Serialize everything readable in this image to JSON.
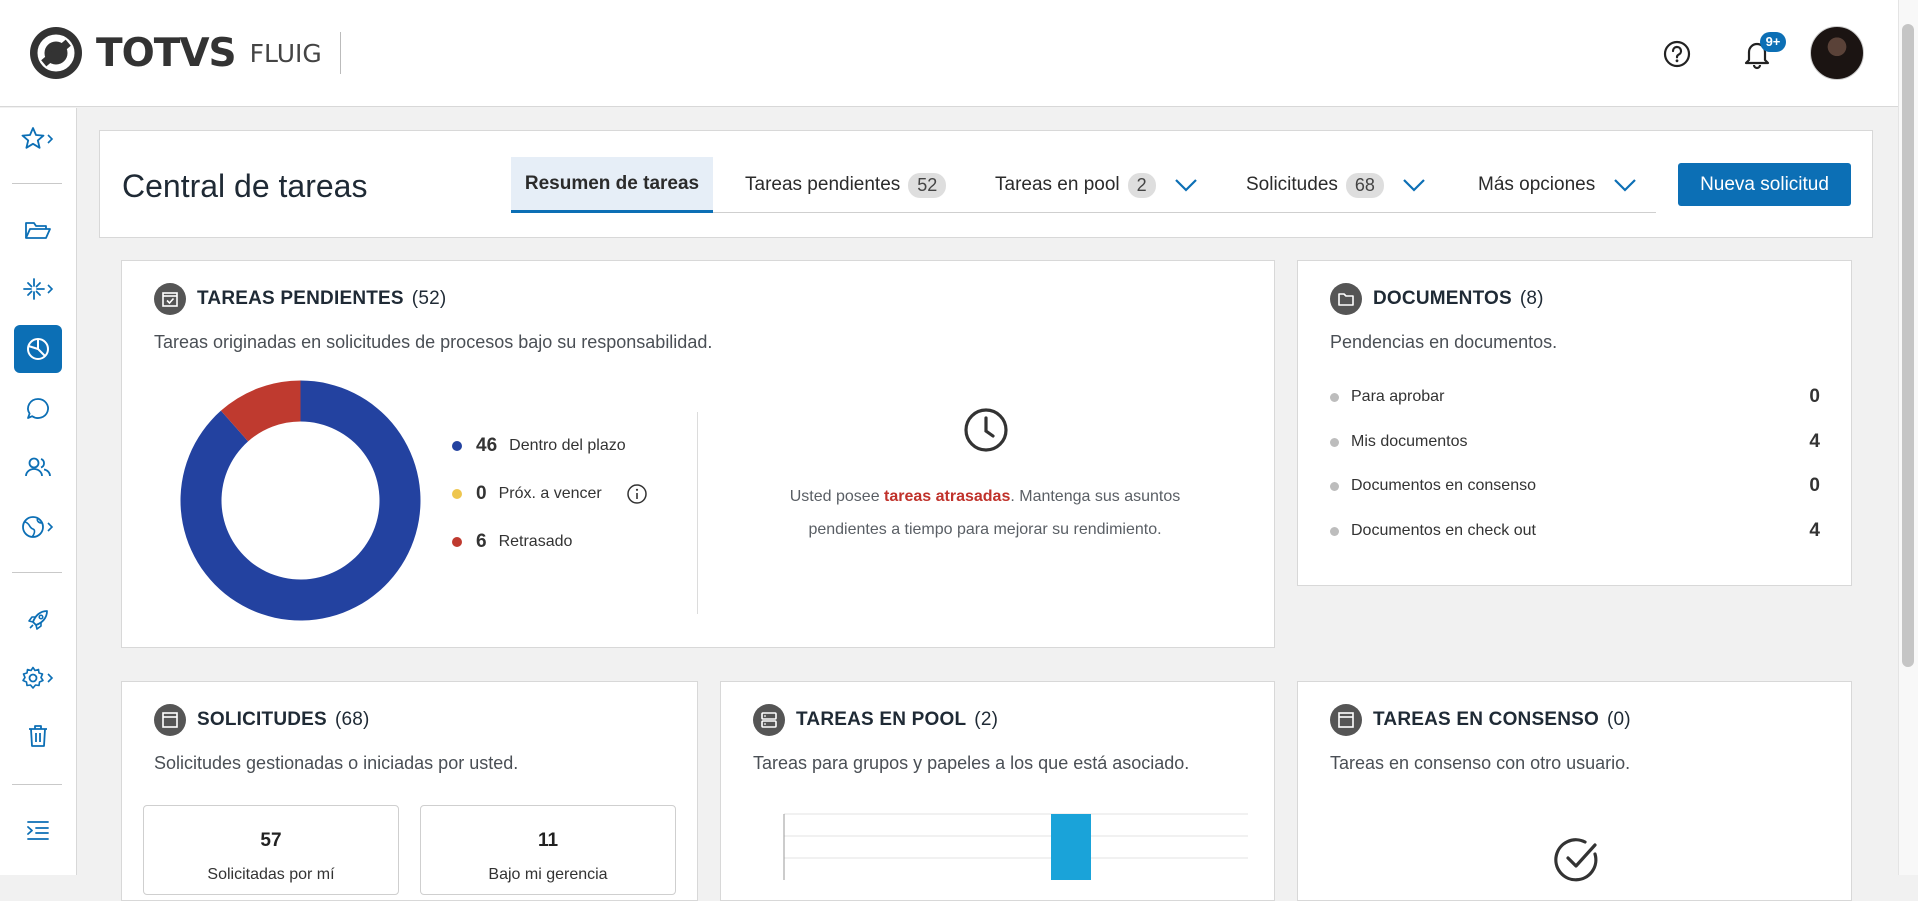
{
  "header": {
    "brand": "TOTVS",
    "product": "FLUIG",
    "notification_badge": "9+"
  },
  "page": {
    "title": "Central de tareas",
    "new_request_label": "Nueva solicitud"
  },
  "tabs": [
    {
      "label": "Resumen de tareas",
      "count": "",
      "active": true
    },
    {
      "label": "Tareas pendientes",
      "count": "52"
    },
    {
      "label": "Tareas en pool",
      "count": "2"
    },
    {
      "label": "Solicitudes",
      "count": "68"
    },
    {
      "label": "Más opciones",
      "count": ""
    }
  ],
  "pending": {
    "title": "TAREAS PENDIENTES",
    "count": "(52)",
    "description": "Tareas originadas en solicitudes de procesos bajo su responsabilidad.",
    "legend": [
      {
        "value": "46",
        "label": "Dentro del plazo",
        "color": "#2342a0"
      },
      {
        "value": "0",
        "label": "Próx. a vencer",
        "color": "#eec64f"
      },
      {
        "value": "6",
        "label": "Retrasado",
        "color": "#bf3a2f"
      }
    ],
    "late_prefix": "Usted posee ",
    "late_link": "tareas atrasadas",
    "late_suffix": ". Mantenga sus asuntos pendientes a tiempo para mejorar su rendimiento."
  },
  "documents": {
    "title": "DOCUMENTOS",
    "count": "(8)",
    "description": "Pendencias en documentos.",
    "rows": [
      {
        "label": "Para aprobar",
        "value": "0"
      },
      {
        "label": "Mis documentos",
        "value": "4"
      },
      {
        "label": "Documentos en consenso",
        "value": "0"
      },
      {
        "label": "Documentos en check out",
        "value": "4"
      }
    ]
  },
  "requests": {
    "title": "SOLICITUDES",
    "count": "(68)",
    "description": "Solicitudes gestionadas o iniciadas por usted.",
    "boxes": [
      {
        "value": "57",
        "label": "Solicitadas por mí"
      },
      {
        "value": "11",
        "label": "Bajo mi gerencia"
      }
    ]
  },
  "pool": {
    "title": "TAREAS EN POOL",
    "count": "(2)",
    "description": "Tareas para grupos y papeles a los que está asociado."
  },
  "consensus": {
    "title": "TAREAS EN CONSENSO",
    "count": "(0)",
    "description": "Tareas en consenso con otro usuario."
  },
  "chart_data": {
    "type": "pie",
    "categories": [
      "Dentro del plazo",
      "Próx. a vencer",
      "Retrasado"
    ],
    "values": [
      46,
      0,
      6
    ],
    "colors": [
      "#2342a0",
      "#eec64f",
      "#bf3a2f"
    ]
  }
}
